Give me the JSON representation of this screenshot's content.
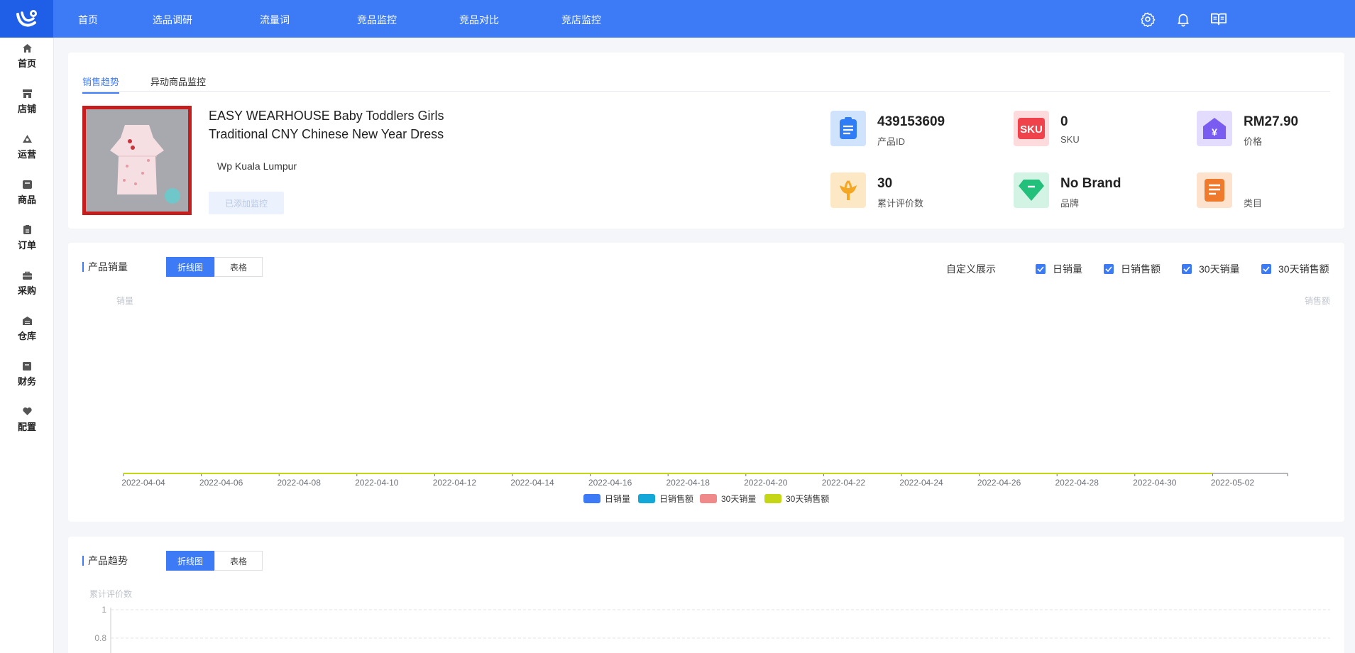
{
  "nav": {
    "items": [
      "首页",
      "选品调研",
      "流量词",
      "竞品监控",
      "竞品对比",
      "竞店监控"
    ]
  },
  "sidebar": {
    "items": [
      {
        "label": "首页",
        "icon": "home-icon"
      },
      {
        "label": "店铺",
        "icon": "store-icon"
      },
      {
        "label": "运营",
        "icon": "operations-icon"
      },
      {
        "label": "商品",
        "icon": "product-icon"
      },
      {
        "label": "订单",
        "icon": "order-icon"
      },
      {
        "label": "采购",
        "icon": "purchase-icon"
      },
      {
        "label": "仓库",
        "icon": "warehouse-icon"
      },
      {
        "label": "财务",
        "icon": "finance-icon"
      },
      {
        "label": "配置",
        "icon": "config-icon"
      }
    ]
  },
  "tabs": [
    "销售趋势",
    "异动商品监控"
  ],
  "product": {
    "title_line1": "EASY WEARHOUSE Baby Toddlers Girls",
    "title_line2": "Traditional CNY Chinese New Year Dress",
    "location": "Wp Kuala Lumpur",
    "added_label": "已添加监控"
  },
  "stats": [
    {
      "value": "439153609",
      "label": "产品ID",
      "icon": "clipboard-icon",
      "color": "#2f7df6"
    },
    {
      "value": "0",
      "label": "SKU",
      "icon": "sku-icon",
      "color": "#f0424a"
    },
    {
      "value": "RM27.90",
      "label": "价格",
      "icon": "price-icon",
      "color": "#7b5cf0"
    },
    {
      "value": "30",
      "label": "累计评价数",
      "icon": "flower-icon",
      "color": "#f5a623"
    },
    {
      "value": "No Brand",
      "label": "品牌",
      "icon": "diamond-icon",
      "color": "#22c07a"
    },
    {
      "value": "",
      "label": "类目",
      "icon": "category-icon",
      "color": "#f07a2c"
    }
  ],
  "sales_section": {
    "title": "产品销量",
    "seg": [
      "折线图",
      "表格"
    ],
    "custom_label": "自定义展示",
    "checkboxes": [
      "日销量",
      "日销售额",
      "30天销量",
      "30天销售额"
    ],
    "left_axis": "销量",
    "right_axis": "销售额"
  },
  "trend_section": {
    "title": "产品趋势",
    "seg": [
      "折线图",
      "表格"
    ],
    "axis_name": "累计评价数"
  },
  "chart_data": [
    {
      "type": "line",
      "title": "产品销量",
      "x": [
        "2022-04-04",
        "2022-04-06",
        "2022-04-08",
        "2022-04-10",
        "2022-04-12",
        "2022-04-14",
        "2022-04-16",
        "2022-04-18",
        "2022-04-20",
        "2022-04-22",
        "2022-04-24",
        "2022-04-26",
        "2022-04-28",
        "2022-04-30",
        "2022-05-02"
      ],
      "ylabel": "销量",
      "y2label": "销售额",
      "series": [
        {
          "name": "日销量",
          "color": "#3c7bf5",
          "values": [
            0,
            0,
            0,
            0,
            0,
            0,
            0,
            0,
            0,
            0,
            0,
            0,
            0,
            0,
            0
          ]
        },
        {
          "name": "日销售额",
          "color": "#13a8d8",
          "values": [
            0,
            0,
            0,
            0,
            0,
            0,
            0,
            0,
            0,
            0,
            0,
            0,
            0,
            0,
            0
          ]
        },
        {
          "name": "30天销量",
          "color": "#f08a8a",
          "values": [
            0,
            0,
            0,
            0,
            0,
            0,
            0,
            0,
            0,
            0,
            0,
            0,
            0,
            0,
            0
          ]
        },
        {
          "name": "30天销售额",
          "color": "#c5d616",
          "values": [
            0,
            0,
            0,
            0,
            0,
            0,
            0,
            0,
            0,
            0,
            0,
            0,
            0,
            0,
            0
          ]
        }
      ],
      "legend": "bottom",
      "grid": false
    },
    {
      "type": "line",
      "title": "产品趋势",
      "ylabel": "累计评价数",
      "y_ticks": [
        "1",
        "0.8"
      ],
      "ylim": [
        0,
        1
      ],
      "grid": true
    }
  ]
}
